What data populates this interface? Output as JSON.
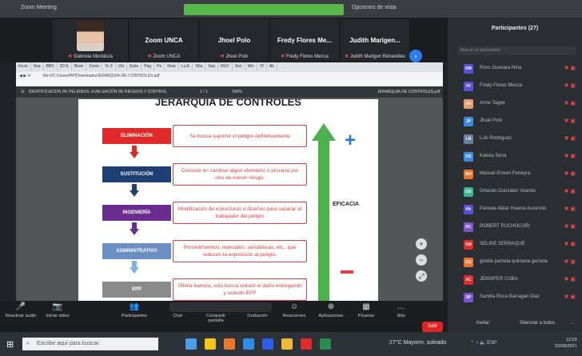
{
  "window": {
    "title": "Zoom Meeting",
    "view_option": "Opciones de vista"
  },
  "gallery": {
    "tiles": [
      {
        "name": "",
        "sub": "Gabriela Mendoza"
      },
      {
        "name": "Zoom UNCA",
        "sub": "Zoom UNCA"
      },
      {
        "name": "Jhoel Polo",
        "sub": "Jhoel Polo"
      },
      {
        "name": "Fredy Flores Me...",
        "sub": "Fredy Flores Mecca"
      },
      {
        "name": "Judith Marigen...",
        "sub": "Judith Marigen Benavides"
      }
    ],
    "next_icon": "›"
  },
  "browser": {
    "tabs": [
      "Inicio",
      "Sea",
      "BBS",
      "3D E",
      "Niver",
      "Zoom",
      "Te 3",
      "Vid",
      "Subs",
      "Pag",
      "Pe",
      "Rear",
      "La E",
      "Sha",
      "Sep",
      "NUV",
      "Sen",
      "Mm",
      "Vf",
      "Ab"
    ],
    "address": "file:///C:/Users/HP/Downloads/JERARQUIA-DE-CONTROLES.pdf",
    "pdf_title": "IDENTIFICACIÓN DE PELIGROS, EVALUACIÓN DE RIESGOS Y CONTROL",
    "pdf_filename": "JERARQUIA-DE-CONTROLES.pdf",
    "pdf_pages": "1 / 1",
    "pdf_zoom": "100%"
  },
  "slide": {
    "title": "JERARQUÍA DE CONTROLES",
    "levels": [
      {
        "label": "ELIMINACIÓN",
        "color": "#e02a2a",
        "desc": "Se busca suprimir el peligro definitivamente"
      },
      {
        "label": "SUSTITUCIÓN",
        "color": "#1e3f73",
        "desc": "Consiste en cambiar algún elemento o proceso por otro de menor riesgo."
      },
      {
        "label": "INGENIERÍA",
        "color": "#6a2c8f",
        "desc": "Modificación de estructuras o diseños para separar al trabajador del peligro"
      },
      {
        "label": "ADMINISTRATIVO",
        "color": "#6b8fc4",
        "desc": "Procedimientos, manuales, señaléticas, etc., que reducen la exposición al peligro."
      },
      {
        "label": "EPP",
        "color": "#8a8a8a",
        "desc": "Última barrera, solo busca reducir el daño entregando y usando EPP"
      }
    ],
    "arrow_colors": [
      "#e02a2a",
      "#1e3f73",
      "#6a2c8f",
      "#7fb0e0"
    ],
    "efficacy_label": "EFICACIA",
    "plus": "+",
    "arrow_color": "#4cb04c"
  },
  "zoom_controls": [
    "+",
    "−",
    "⤢"
  ],
  "participants": {
    "title": "Participantes (27)",
    "search_placeholder": "Buscar un participante",
    "items": [
      {
        "initials": "RM",
        "name": "Ross Guevara Nina",
        "color": "#5a4fd8"
      },
      {
        "initials": "FF",
        "name": "Fredy Flores Mecca",
        "color": "#5a4fd8"
      },
      {
        "initials": "AV",
        "name": "Anne Taype",
        "color": "#e79c6a"
      },
      {
        "initials": "JP",
        "name": "Jhoel Polo",
        "color": "#3b8ce0"
      },
      {
        "initials": "LR",
        "name": "Luis Rodriguez",
        "color": "#6a7fa6"
      },
      {
        "initials": "KS",
        "name": "Kalixia Sena",
        "color": "#3b8ce0"
      },
      {
        "initials": "MH",
        "name": "Manuel Ermen Ferreyra",
        "color": "#e8772e"
      },
      {
        "initials": "OG",
        "name": "Orlando González Vicente",
        "color": "#3bb49a"
      },
      {
        "initials": "PA",
        "name": "Pamela Aldaz Huarca Ascencio",
        "color": "#5a4fd8"
      },
      {
        "initials": "RC",
        "name": "ROBERT PUCHOCURI",
        "color": "#7a56c8"
      },
      {
        "initials": "SM",
        "name": "SELINE SERNAQUE",
        "color": "#e02a2a"
      },
      {
        "initials": "DQ",
        "name": "gisella pamela quintana garzeta",
        "color": "#e8772e"
      },
      {
        "initials": "AC",
        "name": "JENNIFER CUBA",
        "color": "#e02a2a"
      },
      {
        "initials": "SP",
        "name": "Sandra Roca Barragan Diaz",
        "color": "#7a56c8"
      }
    ],
    "foot_invite": "Invitar",
    "foot_mute": "Silenciar a todos",
    "foot_more": "..."
  },
  "controls": [
    {
      "icon": "🎤",
      "label": "Reactivar audio"
    },
    {
      "icon": "📷",
      "label": "Iniciar video"
    },
    {
      "icon": "👥",
      "label": "Participantes"
    },
    {
      "icon": "💬",
      "label": "Chat"
    },
    {
      "icon": "⬆",
      "label": "Compartir pantalla"
    },
    {
      "icon": "⏺",
      "label": "Grabación"
    },
    {
      "icon": "☺",
      "label": "Reacciones"
    },
    {
      "icon": "⊕",
      "label": "Aplicaciones"
    },
    {
      "icon": "▦",
      "label": "Pizarras"
    },
    {
      "icon": "…",
      "label": "Más"
    }
  ],
  "leave_label": "Salir",
  "taskbar": {
    "search_placeholder": "Escribe aquí para buscar",
    "weather": "27°C Mayorm. soleado",
    "clock_time": "12:03",
    "clock_date": "22/09/2021",
    "tray": "ESP",
    "app_colors": [
      "#4a9fe8",
      "#f5c518",
      "#e8772e",
      "#2d8ce8",
      "#2d5ce8",
      "#f0b93a",
      "#e02a2a",
      "#2a8c4c"
    ]
  }
}
